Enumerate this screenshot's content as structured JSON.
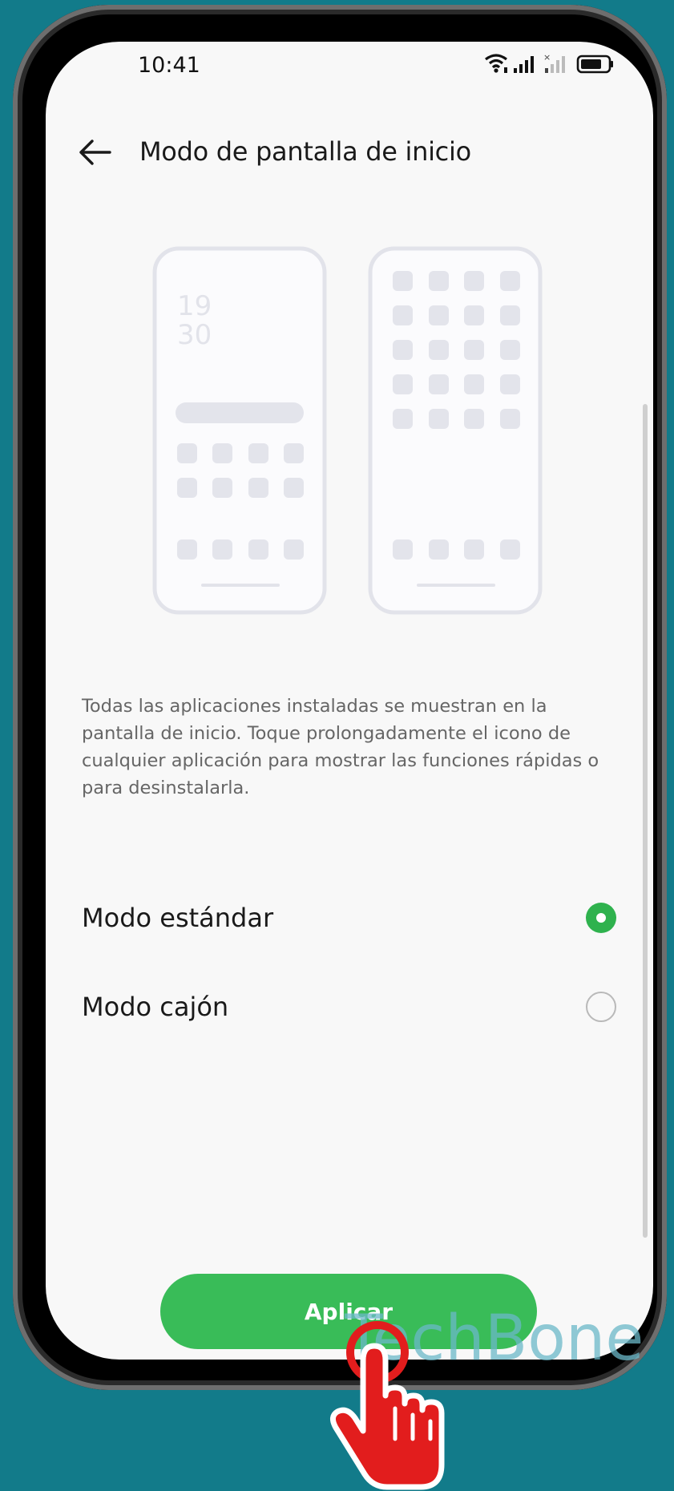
{
  "status_bar": {
    "time": "10:41",
    "icons": [
      "wifi-icon",
      "signal-icon",
      "signal-no-sim-icon",
      "battery-icon"
    ]
  },
  "header": {
    "back_icon": "arrow-left-icon",
    "title": "Modo de pantalla de inicio"
  },
  "illustration": {
    "standard_preview_clock": [
      "19",
      "30"
    ],
    "drawer_preview_grid": "4x5 icon grid"
  },
  "description": "Todas las aplicaciones instaladas se muestran en la pantalla de inicio. Toque prolongadamente el icono de cualquier aplicación para mostrar las funciones rápidas o para desinstalarla.",
  "options": [
    {
      "label": "Modo estándar",
      "selected": true
    },
    {
      "label": "Modo cajón",
      "selected": false
    }
  ],
  "apply_button": {
    "label": "Aplicar"
  },
  "watermark": "TechBone",
  "colors": {
    "background": "#127b8a",
    "accent_green": "#39bc58",
    "radio_selected": "#2fb24e",
    "cursor_red": "#e21d1d"
  }
}
